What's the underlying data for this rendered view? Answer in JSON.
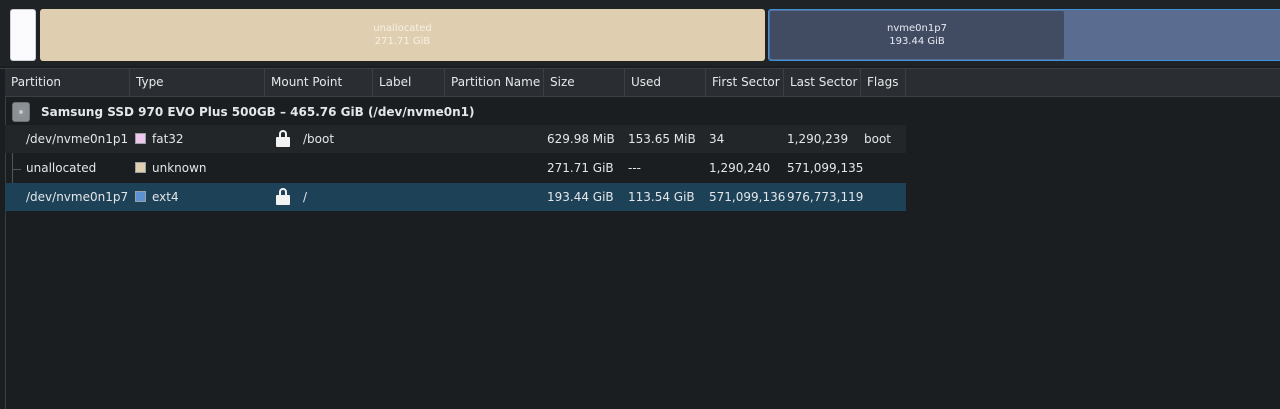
{
  "map": {
    "unallocated": {
      "name": "unallocated",
      "size": "271.71 GiB"
    },
    "root": {
      "name": "nvme0n1p7",
      "size": "193.44 GiB"
    }
  },
  "columns": [
    "Partition",
    "Type",
    "Mount Point",
    "Label",
    "Partition Name",
    "Size",
    "Used",
    "First Sector",
    "Last Sector",
    "Flags"
  ],
  "disk": {
    "label": "Samsung SSD 970 EVO Plus 500GB – 465.76 GiB (/dev/nvme0n1)",
    "icon": "drive-harddisk-icon"
  },
  "partitions": [
    {
      "partition": "/dev/nvme0n1p1",
      "type": "fat32",
      "type_color": "#f0c8ee",
      "mounted": true,
      "mount_point": "/boot",
      "label": "",
      "partition_name": "",
      "size": "629.98 MiB",
      "used": "153.65 MiB",
      "first_sector": "34",
      "last_sector": "1,290,239",
      "flags": "boot"
    },
    {
      "partition": "unallocated",
      "type": "unknown",
      "type_color": "#e0cfae",
      "mounted": false,
      "mount_point": "",
      "label": "",
      "partition_name": "",
      "size": "271.71 GiB",
      "used": "---",
      "first_sector": "1,290,240",
      "last_sector": "571,099,135",
      "flags": ""
    },
    {
      "partition": "/dev/nvme0n1p7",
      "type": "ext4",
      "type_color": "#5b93d1",
      "mounted": true,
      "mount_point": "/",
      "label": "",
      "partition_name": "",
      "size": "193.44 GiB",
      "used": "113.54 GiB",
      "first_sector": "571,099,136",
      "last_sector": "976,773,119",
      "flags": ""
    }
  ],
  "selected_row": 2
}
